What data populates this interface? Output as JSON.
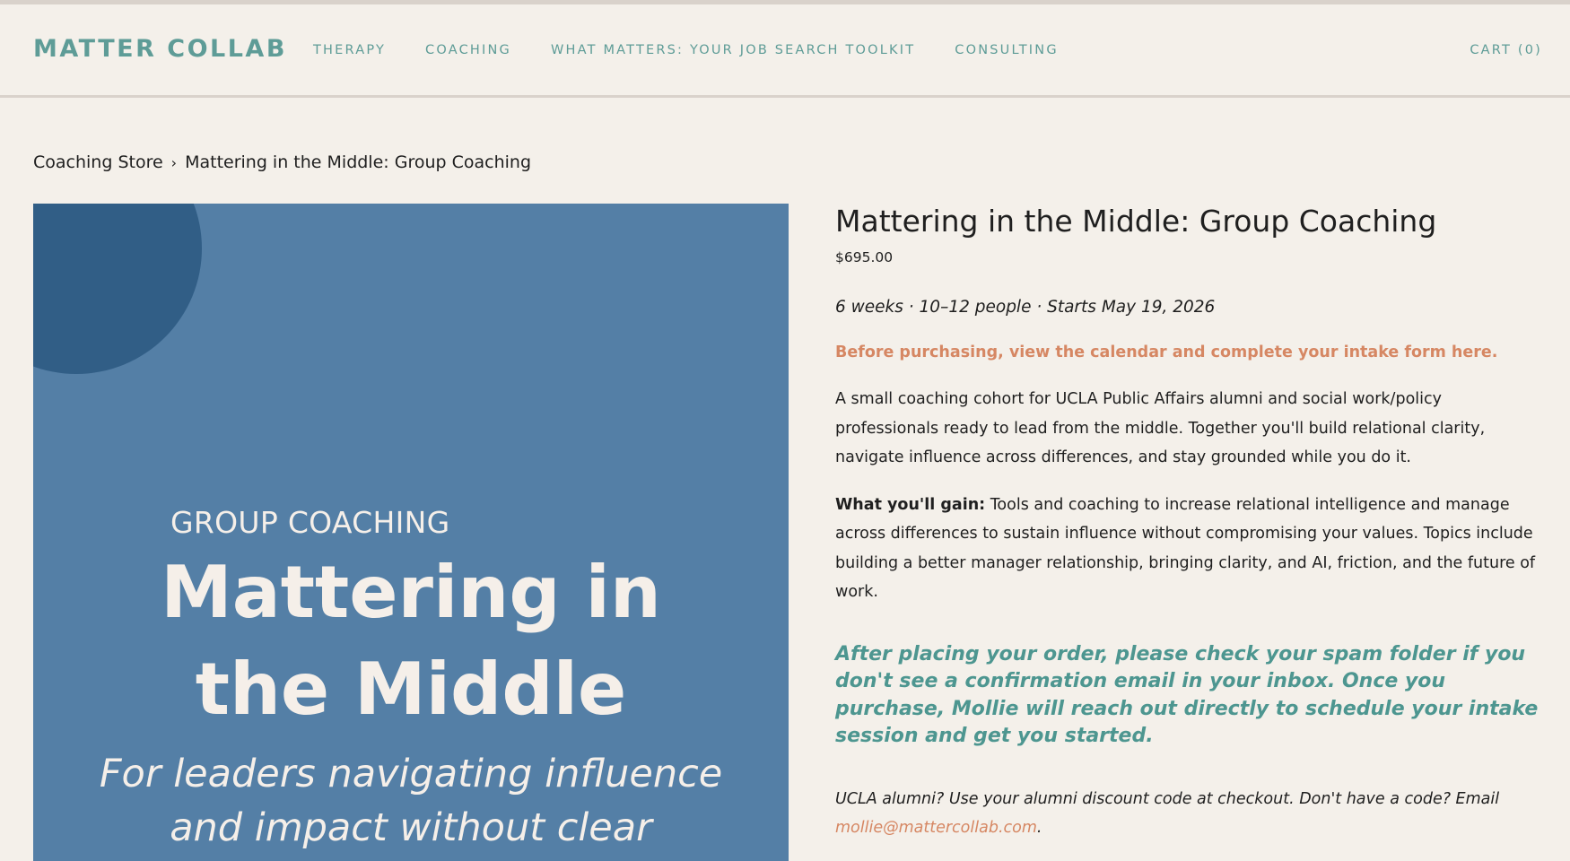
{
  "header": {
    "logo": "MATTER COLLAB",
    "nav": [
      "THERAPY",
      "COACHING",
      "WHAT MATTERS: YOUR JOB SEARCH TOOLKIT",
      "CONSULTING"
    ],
    "cart": "CART (0)"
  },
  "breadcrumb": {
    "parent": "Coaching Store",
    "separator": "›",
    "current": "Mattering in the Middle: Group Coaching"
  },
  "product_image": {
    "kicker": "GROUP COACHING",
    "title_line1": "Mattering in",
    "title_line2": "the Middle",
    "subtitle_line1": "For leaders navigating influence",
    "subtitle_line2": "and impact without clear"
  },
  "product": {
    "title": "Mattering in the Middle: Group Coaching",
    "price": "$695.00",
    "meta": "6 weeks · 10–12 people · Starts May 19, 2026",
    "intake_link": "Before purchasing, view the calendar and complete your intake form here.",
    "description": "A small coaching cohort for UCLA Public Affairs alumni and social work/policy professionals ready to lead from the middle. Together you'll build relational clarity, navigate influence across differences, and stay grounded while you do it.",
    "gain_label": "What you'll gain:",
    "gain_text": " Tools and coaching to increase relational intelligence and manage across differences to sustain influence without compromising your values. Topics include building a better manager relationship, bringing clarity, and AI, friction, and the future of work.",
    "notice": "After placing your order, please check your spam folder if you don't see a confirmation email in your inbox. Once you purchase, Mollie will reach out directly to schedule your intake session and get you started.",
    "alumni_text": "UCLA alumni? Use your alumni discount code at checkout. Don't have a code? Email ",
    "alumni_email": "mollie@mattercollab.com",
    "alumni_end": "."
  },
  "colors": {
    "background": "#f4f0ea",
    "brand_teal": "#5e9c97",
    "accent_orange": "#d68763",
    "image_blue": "#547fa6",
    "image_circle": "#315e86"
  }
}
